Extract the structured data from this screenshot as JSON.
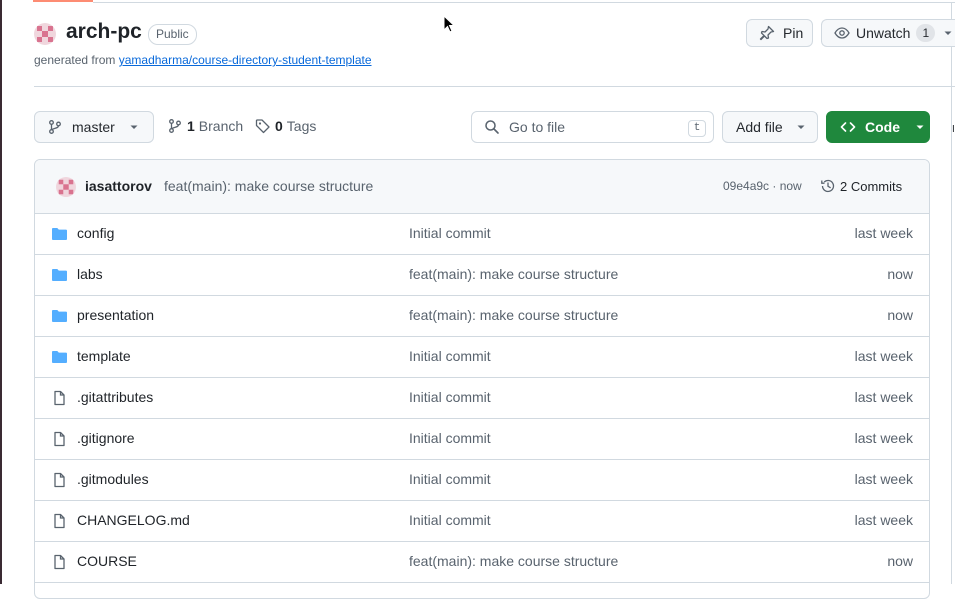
{
  "repo": {
    "name": "arch-pc",
    "visibility": "Public",
    "generated_prefix": "generated from",
    "template_link": "yamadharma/course-directory-student-template"
  },
  "actions": {
    "pin_label": "Pin",
    "watch_label": "Unwatch",
    "watch_count": "1"
  },
  "toolbar": {
    "branch_name": "master",
    "branch_count": "1",
    "branch_label": "Branch",
    "tag_count": "0",
    "tag_label": "Tags",
    "search_placeholder": "Go to file",
    "search_shortcut": "t",
    "add_file_label": "Add file",
    "code_label": "Code"
  },
  "latest_commit": {
    "author": "iasattorov",
    "message": "feat(main): make course structure",
    "hash_time": "09e4a9c · now",
    "commits_label": "2 Commits"
  },
  "files": [
    {
      "type": "folder",
      "name": "config",
      "message": "Initial commit",
      "time": "last week"
    },
    {
      "type": "folder",
      "name": "labs",
      "message": "feat(main): make course structure",
      "time": "now"
    },
    {
      "type": "folder",
      "name": "presentation",
      "message": "feat(main): make course structure",
      "time": "now"
    },
    {
      "type": "folder",
      "name": "template",
      "message": "Initial commit",
      "time": "last week"
    },
    {
      "type": "file",
      "name": ".gitattributes",
      "message": "Initial commit",
      "time": "last week"
    },
    {
      "type": "file",
      "name": ".gitignore",
      "message": "Initial commit",
      "time": "last week"
    },
    {
      "type": "file",
      "name": ".gitmodules",
      "message": "Initial commit",
      "time": "last week"
    },
    {
      "type": "file",
      "name": "CHANGELOG.md",
      "message": "Initial commit",
      "time": "last week"
    },
    {
      "type": "file",
      "name": "COURSE",
      "message": "feat(main): make course structure",
      "time": "now"
    }
  ],
  "colors": {
    "accent_green": "#1f883d",
    "link_blue": "#0969da",
    "folder_blue": "#54aeff",
    "muted_text": "#59636e"
  }
}
